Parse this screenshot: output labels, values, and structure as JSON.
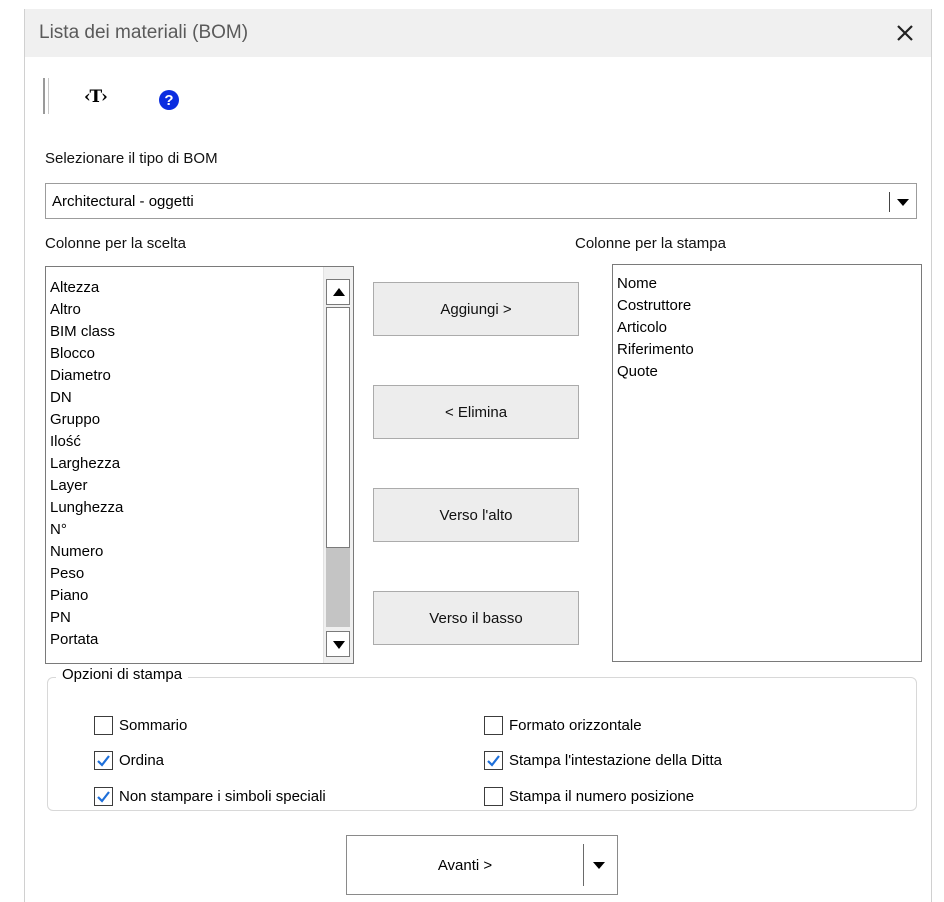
{
  "window": {
    "title": "Lista dei materiali (BOM)"
  },
  "toolbar": {
    "text_tool_label": "‹T›",
    "help_symbol": "?",
    "icons": [
      "toolbar-grip-icon",
      "text-tag-icon",
      "help-icon"
    ]
  },
  "bom_type": {
    "label": "Selezionare il tipo di BOM",
    "selected": "Architectural - oggetti"
  },
  "available_columns": {
    "label": "Colonne per la scelta",
    "items": [
      "Altezza",
      "Altro",
      "BIM class",
      "Blocco",
      "Diametro",
      "DN",
      "Gruppo",
      "Ilość",
      "Larghezza",
      "Layer",
      "Lunghezza",
      "N°",
      "Numero",
      "Peso",
      "Piano",
      "PN",
      "Portata"
    ]
  },
  "print_columns": {
    "label": "Colonne per la stampa",
    "items": [
      "Nome",
      "Costruttore",
      "Articolo",
      "Riferimento",
      "Quote"
    ]
  },
  "buttons": {
    "add": "Aggiungi >",
    "remove": "< Elimina",
    "up": "Verso l'alto",
    "down": "Verso il basso",
    "next": "Avanti >"
  },
  "print_options": {
    "title": "Opzioni di stampa",
    "options": [
      {
        "label": "Sommario",
        "checked": false
      },
      {
        "label": "Formato orizzontale",
        "checked": false
      },
      {
        "label": "Ordina",
        "checked": true
      },
      {
        "label": "Stampa l'intestazione della Ditta",
        "checked": true
      },
      {
        "label": "Non stampare i simboli speciali",
        "checked": true
      },
      {
        "label": "Stampa il numero posizione",
        "checked": false
      }
    ]
  },
  "colors": {
    "check_mark": "#1e6fd9",
    "help_icon": "#0b2de0",
    "titlebar": "#f0f0f0"
  }
}
